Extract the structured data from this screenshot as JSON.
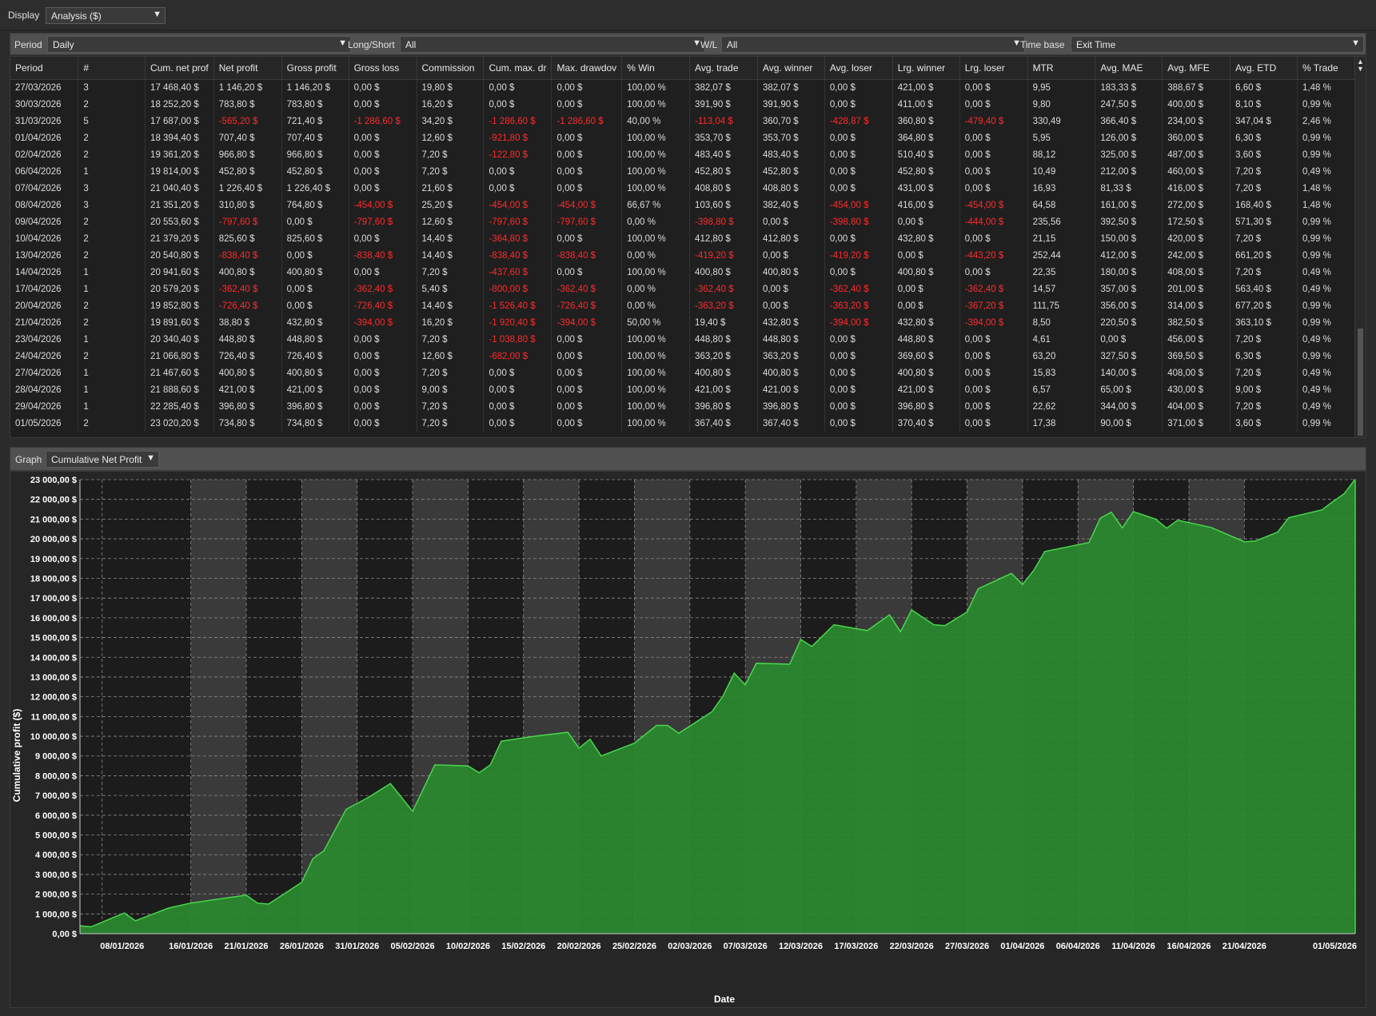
{
  "toolbar": {
    "display_label": "Display",
    "display_value": "Analysis ($)"
  },
  "filters": {
    "period_label": "Period",
    "period_value": "Daily",
    "longshort_label": "Long/Short",
    "longshort_value": "All",
    "wl_label": "W/L",
    "wl_value": "All",
    "timebase_label": "Time base",
    "timebase_value": "Exit Time"
  },
  "table": {
    "columns": [
      "Period",
      "#",
      "Cum. net prof",
      "Net profit",
      "Gross profit",
      "Gross loss",
      "Commission",
      "Cum. max. dr",
      "Max. drawdov",
      "% Win",
      "Avg. trade",
      "Avg. winner",
      "Avg. loser",
      "Lrg. winner",
      "Lrg. loser",
      "MTR",
      "Avg. MAE",
      "Avg. MFE",
      "Avg. ETD",
      "% Trade"
    ],
    "rows": [
      [
        "27/03/2026",
        "3",
        "17 468,40 $",
        "1 146,20 $",
        "1 146,20 $",
        "0,00 $",
        "19,80 $",
        "0,00 $",
        "0,00 $",
        "100,00 %",
        "382,07 $",
        "382,07 $",
        "0,00 $",
        "421,00 $",
        "0,00 $",
        "9,95",
        "183,33 $",
        "388,67 $",
        "6,60 $",
        "1,48 %"
      ],
      [
        "30/03/2026",
        "2",
        "18 252,20 $",
        "783,80 $",
        "783,80 $",
        "0,00 $",
        "16,20 $",
        "0,00 $",
        "0,00 $",
        "100,00 %",
        "391,90 $",
        "391,90 $",
        "0,00 $",
        "411,00 $",
        "0,00 $",
        "9,80",
        "247,50 $",
        "400,00 $",
        "8,10 $",
        "0,99 %"
      ],
      [
        "31/03/2026",
        "5",
        "17 687,00 $",
        "-565,20 $",
        "721,40 $",
        "-1 286,60 $",
        "34,20 $",
        "-1 286,60 $",
        "-1 286,60 $",
        "40,00 %",
        "-113,04 $",
        "360,70 $",
        "-428,87 $",
        "360,80 $",
        "-479,40 $",
        "330,49",
        "366,40 $",
        "234,00 $",
        "347,04 $",
        "2,46 %"
      ],
      [
        "01/04/2026",
        "2",
        "18 394,40 $",
        "707,40 $",
        "707,40 $",
        "0,00 $",
        "12,60 $",
        "-921,80 $",
        "0,00 $",
        "100,00 %",
        "353,70 $",
        "353,70 $",
        "0,00 $",
        "364,80 $",
        "0,00 $",
        "5,95",
        "126,00 $",
        "360,00 $",
        "6,30 $",
        "0,99 %"
      ],
      [
        "02/04/2026",
        "2",
        "19 361,20 $",
        "966,80 $",
        "966,80 $",
        "0,00 $",
        "7,20 $",
        "-122,80 $",
        "0,00 $",
        "100,00 %",
        "483,40 $",
        "483,40 $",
        "0,00 $",
        "510,40 $",
        "0,00 $",
        "88,12",
        "325,00 $",
        "487,00 $",
        "3,60 $",
        "0,99 %"
      ],
      [
        "06/04/2026",
        "1",
        "19 814,00 $",
        "452,80 $",
        "452,80 $",
        "0,00 $",
        "7,20 $",
        "0,00 $",
        "0,00 $",
        "100,00 %",
        "452,80 $",
        "452,80 $",
        "0,00 $",
        "452,80 $",
        "0,00 $",
        "10,49",
        "212,00 $",
        "460,00 $",
        "7,20 $",
        "0,49 %"
      ],
      [
        "07/04/2026",
        "3",
        "21 040,40 $",
        "1 226,40 $",
        "1 226,40 $",
        "0,00 $",
        "21,60 $",
        "0,00 $",
        "0,00 $",
        "100,00 %",
        "408,80 $",
        "408,80 $",
        "0,00 $",
        "431,00 $",
        "0,00 $",
        "16,93",
        "81,33 $",
        "416,00 $",
        "7,20 $",
        "1,48 %"
      ],
      [
        "08/04/2026",
        "3",
        "21 351,20 $",
        "310,80 $",
        "764,80 $",
        "-454,00 $",
        "25,20 $",
        "-454,00 $",
        "-454,00 $",
        "66,67 %",
        "103,60 $",
        "382,40 $",
        "-454,00 $",
        "416,00 $",
        "-454,00 $",
        "64,58",
        "161,00 $",
        "272,00 $",
        "168,40 $",
        "1,48 %"
      ],
      [
        "09/04/2026",
        "2",
        "20 553,60 $",
        "-797,60 $",
        "0,00 $",
        "-797,60 $",
        "12,60 $",
        "-797,60 $",
        "-797,60 $",
        "0,00 %",
        "-398,80 $",
        "0,00 $",
        "-398,80 $",
        "0,00 $",
        "-444,00 $",
        "235,56",
        "392,50 $",
        "172,50 $",
        "571,30 $",
        "0,99 %"
      ],
      [
        "10/04/2026",
        "2",
        "21 379,20 $",
        "825,60 $",
        "825,60 $",
        "0,00 $",
        "14,40 $",
        "-364,80 $",
        "0,00 $",
        "100,00 %",
        "412,80 $",
        "412,80 $",
        "0,00 $",
        "432,80 $",
        "0,00 $",
        "21,15",
        "150,00 $",
        "420,00 $",
        "7,20 $",
        "0,99 %"
      ],
      [
        "13/04/2026",
        "2",
        "20 540,80 $",
        "-838,40 $",
        "0,00 $",
        "-838,40 $",
        "14,40 $",
        "-838,40 $",
        "-838,40 $",
        "0,00 %",
        "-419,20 $",
        "0,00 $",
        "-419,20 $",
        "0,00 $",
        "-443,20 $",
        "252,44",
        "412,00 $",
        "242,00 $",
        "661,20 $",
        "0,99 %"
      ],
      [
        "14/04/2026",
        "1",
        "20 941,60 $",
        "400,80 $",
        "400,80 $",
        "0,00 $",
        "7,20 $",
        "-437,60 $",
        "0,00 $",
        "100,00 %",
        "400,80 $",
        "400,80 $",
        "0,00 $",
        "400,80 $",
        "0,00 $",
        "22,35",
        "180,00 $",
        "408,00 $",
        "7,20 $",
        "0,49 %"
      ],
      [
        "17/04/2026",
        "1",
        "20 579,20 $",
        "-362,40 $",
        "0,00 $",
        "-362,40 $",
        "5,40 $",
        "-800,00 $",
        "-362,40 $",
        "0,00 %",
        "-362,40 $",
        "0,00 $",
        "-362,40 $",
        "0,00 $",
        "-362,40 $",
        "14,57",
        "357,00 $",
        "201,00 $",
        "563,40 $",
        "0,49 %"
      ],
      [
        "20/04/2026",
        "2",
        "19 852,80 $",
        "-726,40 $",
        "0,00 $",
        "-726,40 $",
        "14,40 $",
        "-1 526,40 $",
        "-726,40 $",
        "0,00 %",
        "-363,20 $",
        "0,00 $",
        "-363,20 $",
        "0,00 $",
        "-367,20 $",
        "111,75",
        "356,00 $",
        "314,00 $",
        "677,20 $",
        "0,99 %"
      ],
      [
        "21/04/2026",
        "2",
        "19 891,60 $",
        "38,80 $",
        "432,80 $",
        "-394,00 $",
        "16,20 $",
        "-1 920,40 $",
        "-394,00 $",
        "50,00 %",
        "19,40 $",
        "432,80 $",
        "-394,00 $",
        "432,80 $",
        "-394,00 $",
        "8,50",
        "220,50 $",
        "382,50 $",
        "363,10 $",
        "0,99 %"
      ],
      [
        "23/04/2026",
        "1",
        "20 340,40 $",
        "448,80 $",
        "448,80 $",
        "0,00 $",
        "7,20 $",
        "-1 038,80 $",
        "0,00 $",
        "100,00 %",
        "448,80 $",
        "448,80 $",
        "0,00 $",
        "448,80 $",
        "0,00 $",
        "4,61",
        "0,00 $",
        "456,00 $",
        "7,20 $",
        "0,49 %"
      ],
      [
        "24/04/2026",
        "2",
        "21 066,80 $",
        "726,40 $",
        "726,40 $",
        "0,00 $",
        "12,60 $",
        "-682,00 $",
        "0,00 $",
        "100,00 %",
        "363,20 $",
        "363,20 $",
        "0,00 $",
        "369,60 $",
        "0,00 $",
        "63,20",
        "327,50 $",
        "369,50 $",
        "6,30 $",
        "0,99 %"
      ],
      [
        "27/04/2026",
        "1",
        "21 467,60 $",
        "400,80 $",
        "400,80 $",
        "0,00 $",
        "7,20 $",
        "0,00 $",
        "0,00 $",
        "100,00 %",
        "400,80 $",
        "400,80 $",
        "0,00 $",
        "400,80 $",
        "0,00 $",
        "15,83",
        "140,00 $",
        "408,00 $",
        "7,20 $",
        "0,49 %"
      ],
      [
        "28/04/2026",
        "1",
        "21 888,60 $",
        "421,00 $",
        "421,00 $",
        "0,00 $",
        "9,00 $",
        "0,00 $",
        "0,00 $",
        "100,00 %",
        "421,00 $",
        "421,00 $",
        "0,00 $",
        "421,00 $",
        "0,00 $",
        "6,57",
        "65,00 $",
        "430,00 $",
        "9,00 $",
        "0,49 %"
      ],
      [
        "29/04/2026",
        "1",
        "22 285,40 $",
        "396,80 $",
        "396,80 $",
        "0,00 $",
        "7,20 $",
        "0,00 $",
        "0,00 $",
        "100,00 %",
        "396,80 $",
        "396,80 $",
        "0,00 $",
        "396,80 $",
        "0,00 $",
        "22,62",
        "344,00 $",
        "404,00 $",
        "7,20 $",
        "0,49 %"
      ],
      [
        "01/05/2026",
        "2",
        "23 020,20 $",
        "734,80 $",
        "734,80 $",
        "0,00 $",
        "7,20 $",
        "0,00 $",
        "0,00 $",
        "100,00 %",
        "367,40 $",
        "367,40 $",
        "0,00 $",
        "370,40 $",
        "0,00 $",
        "17,38",
        "90,00 $",
        "371,00 $",
        "3,60 $",
        "0,99 %"
      ]
    ]
  },
  "graph": {
    "label": "Graph",
    "type_value": "Cumulative Net Profit"
  },
  "colors": {
    "area_fill": "#2a8a2f",
    "area_line": "#49d64c",
    "negative": "#ff2a2a",
    "grid": "#8a8a8a",
    "band": "#3a3a3a"
  },
  "chart_data": {
    "type": "area",
    "xlabel": "Date",
    "ylabel": "Cumulative profit ($)",
    "ylim": [
      0,
      23000
    ],
    "y_ticks": [
      "0,00 $",
      "1 000,00 $",
      "2 000,00 $",
      "3 000,00 $",
      "4 000,00 $",
      "5 000,00 $",
      "6 000,00 $",
      "7 000,00 $",
      "8 000,00 $",
      "9 000,00 $",
      "10 000,00 $",
      "11 000,00 $",
      "12 000,00 $",
      "13 000,00 $",
      "14 000,00 $",
      "15 000,00 $",
      "16 000,00 $",
      "17 000,00 $",
      "18 000,00 $",
      "19 000,00 $",
      "20 000,00 $",
      "21 000,00 $",
      "22 000,00 $",
      "23 000,00 $"
    ],
    "x_ticks": [
      "08/01/2026",
      "16/01/2026",
      "21/01/2026",
      "26/01/2026",
      "31/01/2026",
      "05/02/2026",
      "10/02/2026",
      "15/02/2026",
      "20/02/2026",
      "25/02/2026",
      "02/03/2026",
      "07/03/2026",
      "12/03/2026",
      "17/03/2026",
      "22/03/2026",
      "27/03/2026",
      "01/04/2026",
      "06/04/2026",
      "11/04/2026",
      "16/04/2026",
      "21/04/2026",
      "01/05/2026"
    ],
    "x_start": "06/01/2026",
    "x_end": "01/05/2026",
    "grid": true,
    "points": [
      [
        "06/01/2026",
        400
      ],
      [
        "07/01/2026",
        350
      ],
      [
        "10/01/2026",
        1050
      ],
      [
        "11/01/2026",
        650
      ],
      [
        "14/01/2026",
        1300
      ],
      [
        "16/01/2026",
        1550
      ],
      [
        "21/01/2026",
        1950
      ],
      [
        "22/01/2026",
        1550
      ],
      [
        "23/01/2026",
        1500
      ],
      [
        "26/01/2026",
        2600
      ],
      [
        "27/01/2026",
        3800
      ],
      [
        "28/01/2026",
        4200
      ],
      [
        "30/01/2026",
        6300
      ],
      [
        "01/02/2026",
        6900
      ],
      [
        "03/02/2026",
        7600
      ],
      [
        "05/02/2026",
        6200
      ],
      [
        "07/02/2026",
        8550
      ],
      [
        "10/02/2026",
        8500
      ],
      [
        "11/02/2026",
        8150
      ],
      [
        "12/02/2026",
        8550
      ],
      [
        "13/02/2026",
        9750
      ],
      [
        "16/02/2026",
        10000
      ],
      [
        "19/02/2026",
        10200
      ],
      [
        "20/02/2026",
        9400
      ],
      [
        "21/02/2026",
        9850
      ],
      [
        "22/02/2026",
        9000
      ],
      [
        "25/02/2026",
        9650
      ],
      [
        "27/02/2026",
        10550
      ],
      [
        "28/02/2026",
        10550
      ],
      [
        "01/03/2026",
        10150
      ],
      [
        "04/03/2026",
        11250
      ],
      [
        "05/03/2026",
        12050
      ],
      [
        "06/03/2026",
        13200
      ],
      [
        "07/03/2026",
        12600
      ],
      [
        "08/03/2026",
        13700
      ],
      [
        "11/03/2026",
        13650
      ],
      [
        "12/03/2026",
        14900
      ],
      [
        "13/03/2026",
        14550
      ],
      [
        "15/03/2026",
        15650
      ],
      [
        "18/03/2026",
        15350
      ],
      [
        "20/03/2026",
        16150
      ],
      [
        "21/03/2026",
        15300
      ],
      [
        "22/03/2026",
        16400
      ],
      [
        "24/03/2026",
        15650
      ],
      [
        "25/03/2026",
        15600
      ],
      [
        "27/03/2026",
        16300
      ],
      [
        "28/03/2026",
        17468
      ],
      [
        "31/03/2026",
        18252
      ],
      [
        "01/04/2026",
        17687
      ],
      [
        "02/04/2026",
        18394
      ],
      [
        "03/04/2026",
        19361
      ],
      [
        "07/04/2026",
        19814
      ],
      [
        "08/04/2026",
        21040
      ],
      [
        "09/04/2026",
        21351
      ],
      [
        "10/04/2026",
        20554
      ],
      [
        "11/04/2026",
        21379
      ],
      [
        "13/04/2026",
        21000
      ],
      [
        "14/04/2026",
        20541
      ],
      [
        "15/04/2026",
        20942
      ],
      [
        "18/04/2026",
        20579
      ],
      [
        "21/04/2026",
        19853
      ],
      [
        "22/04/2026",
        19892
      ],
      [
        "24/04/2026",
        20340
      ],
      [
        "25/04/2026",
        21067
      ],
      [
        "28/04/2026",
        21468
      ],
      [
        "29/04/2026",
        21889
      ],
      [
        "30/04/2026",
        22285
      ],
      [
        "01/05/2026",
        23020
      ]
    ]
  }
}
